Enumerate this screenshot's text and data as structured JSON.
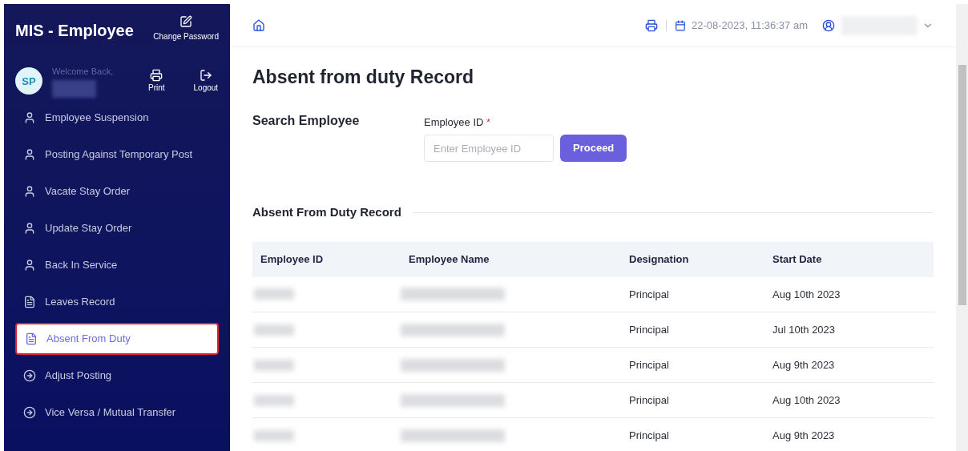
{
  "sidebar": {
    "title": "MIS - Employee",
    "change_password": "Change Password",
    "avatar_initials": "SP",
    "welcome": "Welcome Back,",
    "print": "Print",
    "logout": "Logout",
    "items": [
      {
        "label": "Employee Suspension",
        "kind": "person",
        "selected": false
      },
      {
        "label": "Posting Against Temporary Post",
        "kind": "person",
        "selected": false
      },
      {
        "label": "Vacate Stay Order",
        "kind": "person",
        "selected": false
      },
      {
        "label": "Update Stay Order",
        "kind": "person",
        "selected": false
      },
      {
        "label": "Back In Service",
        "kind": "person",
        "selected": false
      },
      {
        "label": "Leaves Record",
        "kind": "document",
        "selected": false
      },
      {
        "label": "Absent From Duty",
        "kind": "document",
        "selected": true
      },
      {
        "label": "Adjust Posting",
        "kind": "arrow",
        "selected": false
      },
      {
        "label": "Vice Versa / Mutual Transfer",
        "kind": "arrow",
        "selected": false
      }
    ]
  },
  "header": {
    "datetime": "22-08-2023, 11:36:37 am"
  },
  "page_title": "Absent from duty Record",
  "search": {
    "label": "Search Employee",
    "field_label": "Employee ID",
    "required_mark": "*",
    "placeholder": "Enter Employee ID",
    "button": "Proceed"
  },
  "table": {
    "title": "Absent From Duty Record",
    "columns": [
      "Employee ID",
      "Employee Name",
      "Designation",
      "Start Date"
    ],
    "rows": [
      {
        "designation": "Principal",
        "start_date": "Aug 10th 2023"
      },
      {
        "designation": "Principal",
        "start_date": "Jul 10th 2023"
      },
      {
        "designation": "Principal",
        "start_date": "Aug 9th 2023"
      },
      {
        "designation": "Principal",
        "start_date": "Aug 10th 2023"
      },
      {
        "designation": "Principal",
        "start_date": "Aug 9th 2023"
      }
    ]
  }
}
